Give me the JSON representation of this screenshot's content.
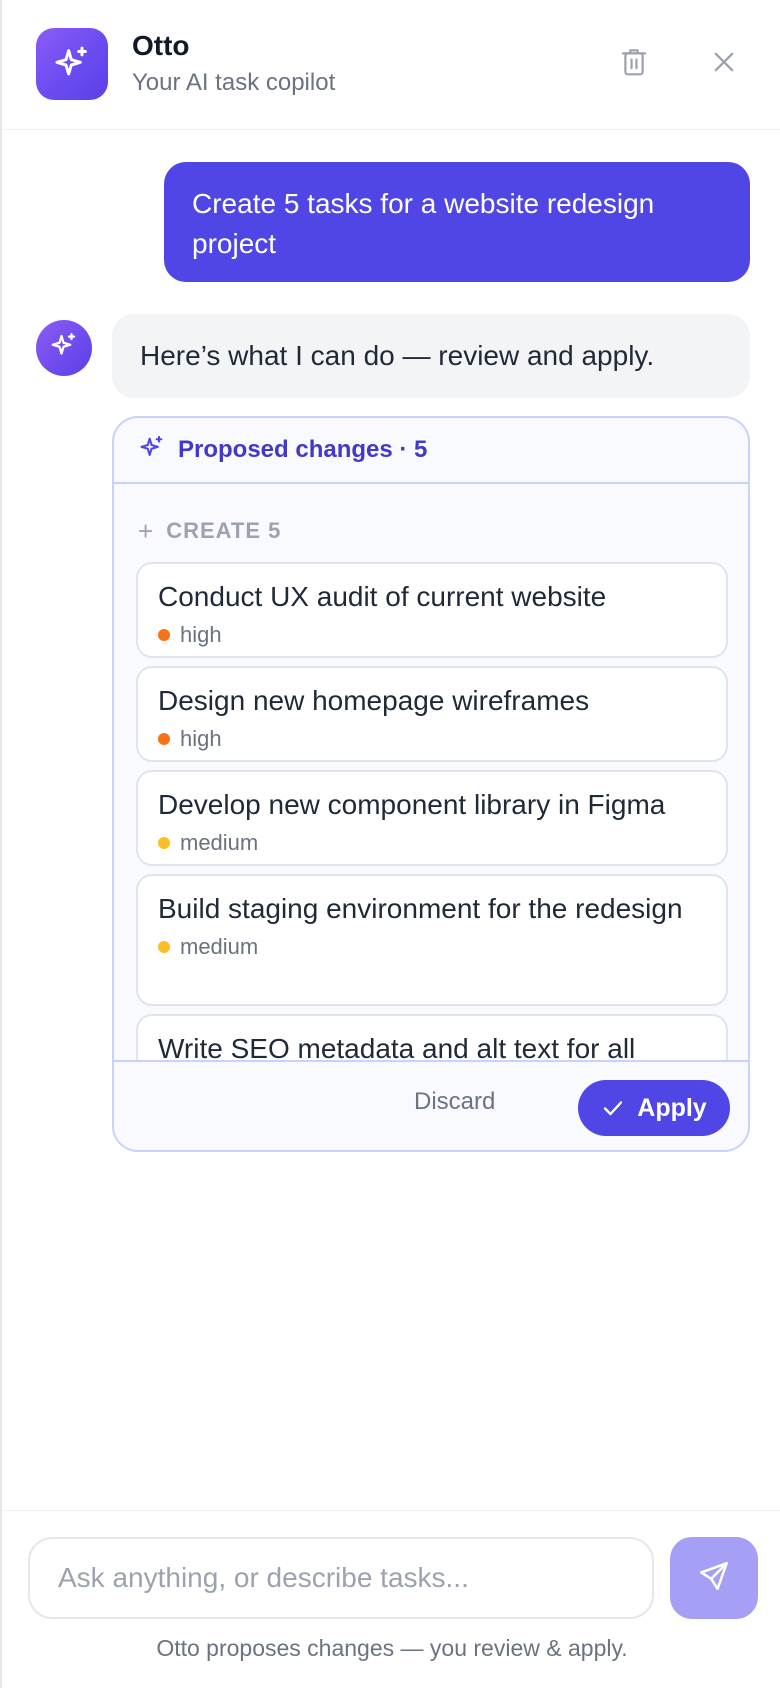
{
  "header": {
    "title": "Otto",
    "subtitle": "Your AI task copilot",
    "logo_icon": "sparkle-icon",
    "delete_icon": "trash-icon",
    "close_icon": "close-icon"
  },
  "conversation": {
    "user_message": "Create 5 tasks for a website redesign project",
    "assistant_message": "Here’s what I can do — review and apply."
  },
  "proposal": {
    "header_label": "Proposed changes · 5",
    "section_label": "CREATE 5",
    "tasks": [
      {
        "title": "Conduct UX audit of current website",
        "priority": "high"
      },
      {
        "title": "Design new homepage wireframes",
        "priority": "high"
      },
      {
        "title": "Develop new component library in Figma",
        "priority": "medium"
      },
      {
        "title": "Build staging environment for the redesign",
        "priority": "medium"
      },
      {
        "title": "Write SEO metadata and alt text for all",
        "priority": ""
      }
    ],
    "discard_label": "Discard",
    "apply_label": "Apply"
  },
  "composer": {
    "placeholder": "Ask anything, or describe tasks...",
    "hint": "Otto proposes changes — you review & apply."
  },
  "colors": {
    "accent": "#4f46e5",
    "high": "#f97316",
    "medium": "#fbbf24"
  }
}
